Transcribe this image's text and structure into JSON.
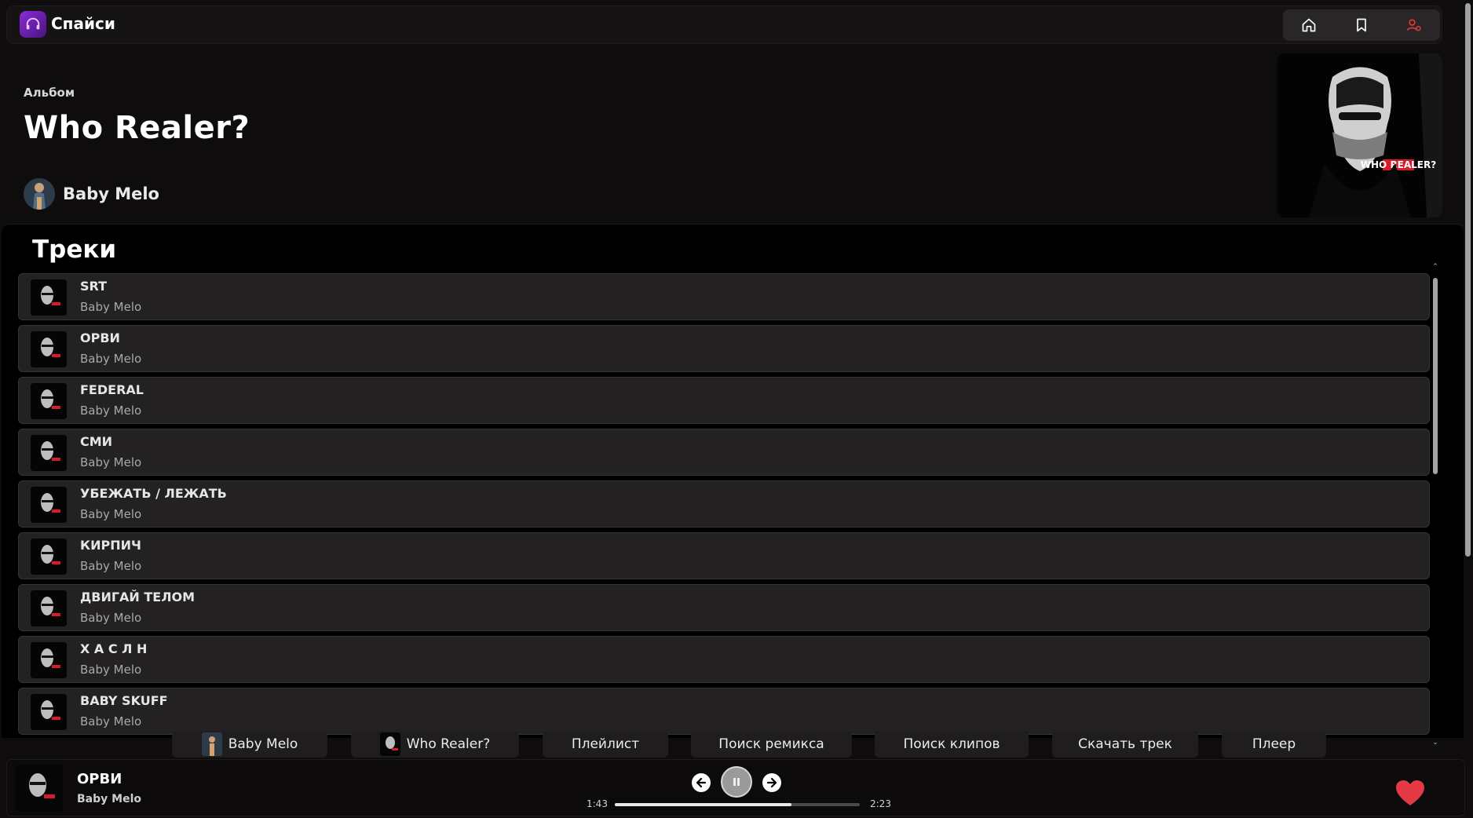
{
  "app": {
    "name": "Спайси",
    "accent": "#7b23c7"
  },
  "nav": {
    "icons": [
      "home-icon",
      "bookmark-icon",
      "user-settings-icon"
    ],
    "active_color": "#e53935"
  },
  "album": {
    "type_label": "Альбом",
    "title": "Who Realer?",
    "artist": "Baby Melo",
    "cover_text": "WHO REALER?"
  },
  "tracks": {
    "heading": "Треки",
    "items": [
      {
        "title": "SRT",
        "artist": "Baby Melo"
      },
      {
        "title": "ОРВИ",
        "artist": "Baby Melo"
      },
      {
        "title": "FEDERAL",
        "artist": "Baby Melo"
      },
      {
        "title": "СМИ",
        "artist": "Baby Melo"
      },
      {
        "title": "УБЕЖАТЬ / ЛЕЖАТЬ",
        "artist": "Baby Melo"
      },
      {
        "title": "КИРПИЧ",
        "artist": "Baby Melo"
      },
      {
        "title": "ДВИГАЙ ТЕЛОМ",
        "artist": "Baby Melo"
      },
      {
        "title": "Х А С Л Н",
        "artist": "Baby Melo"
      },
      {
        "title": "BABY SKUFF",
        "artist": "Baby Melo"
      }
    ]
  },
  "actions": {
    "artist": "Baby Melo",
    "album": "Who Realer?",
    "playlist": "Плейлист",
    "remix_search": "Поиск ремикса",
    "clip_search": "Поиск клипов",
    "download": "Скачать трек",
    "player": "Плеер"
  },
  "player": {
    "title": "ОРВИ",
    "artist": "Baby Melo",
    "current_time": "1:43",
    "total_time": "2:23",
    "progress": 0.72,
    "liked": true,
    "like_color": "#e53946"
  }
}
